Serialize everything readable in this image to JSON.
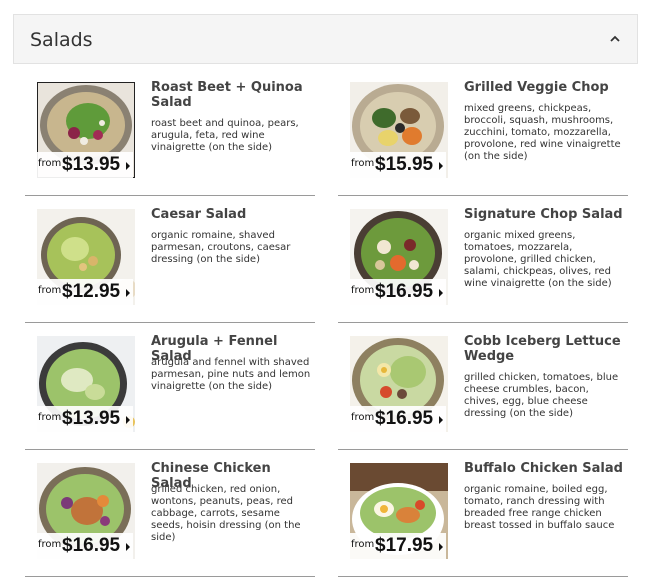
{
  "section": {
    "title": "Salads"
  },
  "price_prefix": "from",
  "items": [
    {
      "name": "Roast Beet + Quinoa Salad",
      "description": "roast beet and quinoa, pears, arugula, feta, red wine vinaigrette (on the side)",
      "price": "$13.95"
    },
    {
      "name": "Grilled Veggie Chop",
      "description": "mixed greens, chickpeas, broccoli, squash, mushrooms, zucchini, tomato, mozzarella, provolone, red wine vinaigrette (on the side)",
      "price": "$15.95"
    },
    {
      "name": "Caesar Salad",
      "description": "organic romaine, shaved parmesan, croutons, caesar dressing (on the side)",
      "price": "$12.95"
    },
    {
      "name": "Signature Chop Salad",
      "description": "organic mixed greens, tomatoes, mozzarela, provolone, grilled chicken, salami, chickpeas, olives, red wine vinaigrette (on the side)",
      "price": "$16.95"
    },
    {
      "name": "Arugula + Fennel Salad",
      "description": "arugula and fennel with shaved parmesan, pine nuts and lemon vinaigrette (on the side)",
      "price": "$13.95"
    },
    {
      "name": "Cobb Iceberg Lettuce Wedge",
      "description": "grilled chicken, tomatoes, blue cheese crumbles, bacon, chives, egg, blue cheese dressing (on the side)",
      "price": "$16.95"
    },
    {
      "name": "Chinese Chicken Salad",
      "description": "grilled chicken, red onion, wontons, peanuts, peas, red cabbage, carrots, sesame seeds, hoisin dressing (on the side)",
      "price": "$16.95"
    },
    {
      "name": "Buffalo Chicken Salad",
      "description": "organic romaine, boiled egg, tomato, ranch dressing with breaded free range chicken breast tossed in buffalo sauce",
      "price": "$17.95"
    }
  ]
}
